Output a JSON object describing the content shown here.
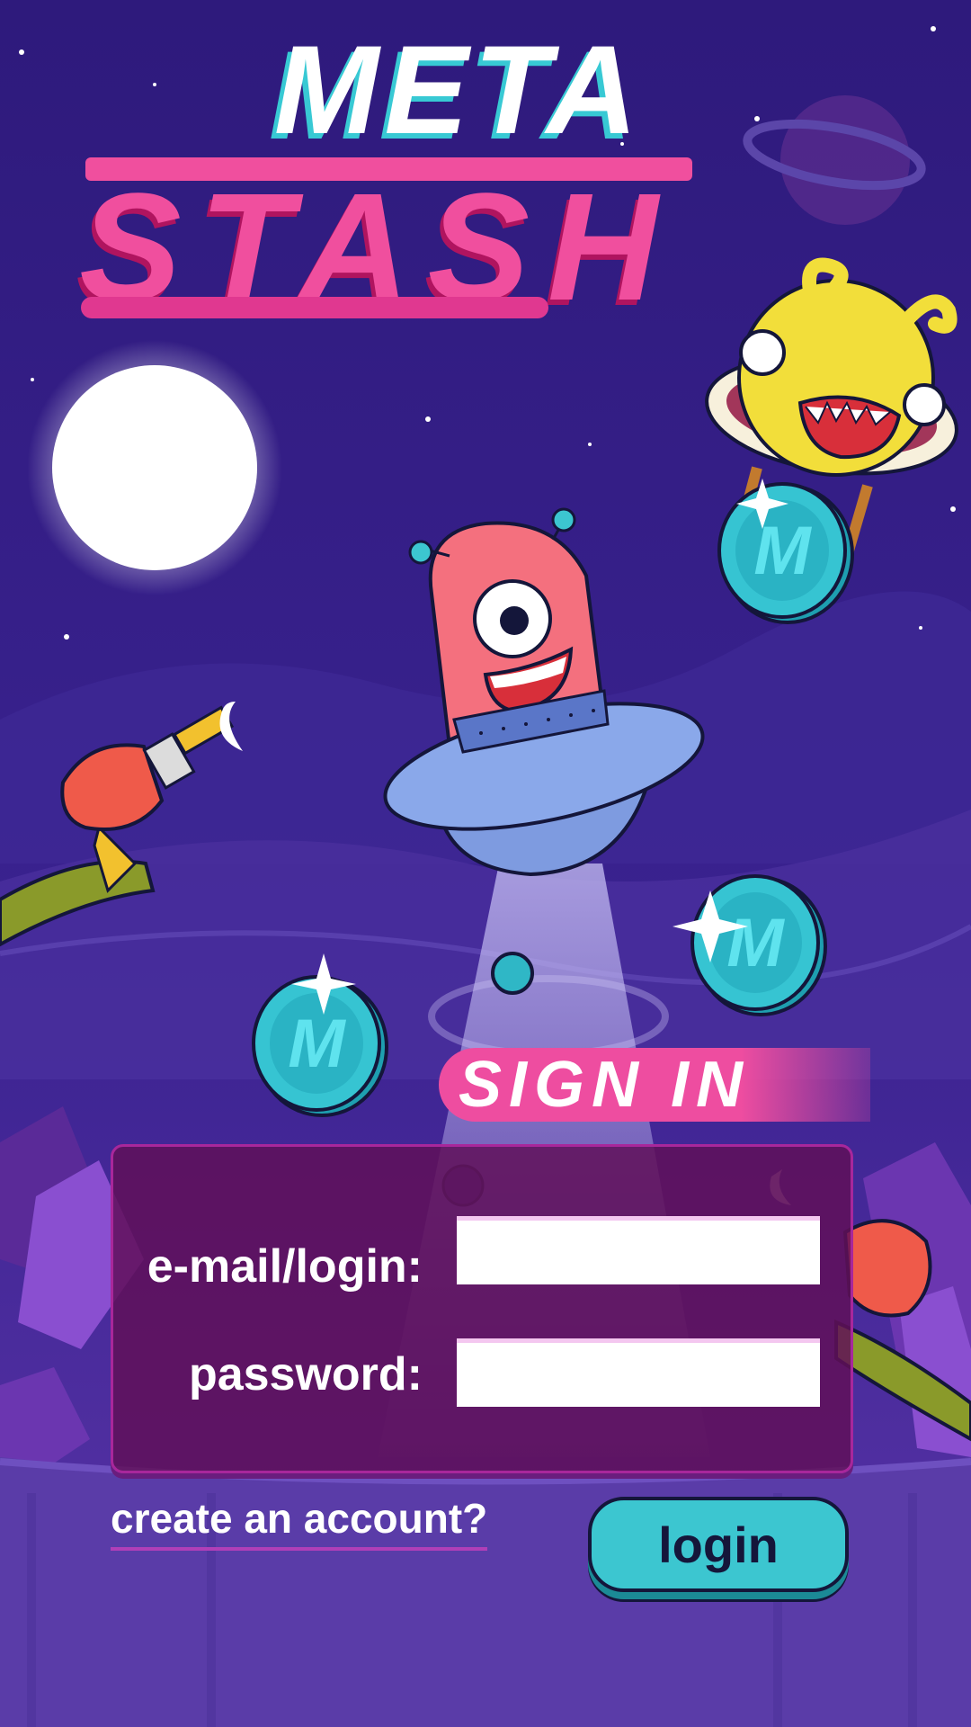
{
  "game": {
    "title_line1": "META",
    "title_line2": "STASH"
  },
  "signin": {
    "heading": "SIGN IN",
    "email_label": "e-mail/login:",
    "email_value": "",
    "password_label": "password:",
    "password_value": "",
    "create_account_link": "create an account?",
    "login_button": "login"
  },
  "coin": {
    "letter": "M"
  },
  "colors": {
    "sky": "#2b1a78",
    "accent_pink": "#f04f9e",
    "accent_cyan": "#3cc6d0",
    "panel": "#601058",
    "alien_pink": "#f4707e",
    "alien_yellow": "#f2de3a",
    "ufo_blue": "#7e9be0"
  },
  "icons": [
    "moon-icon",
    "planet-icon",
    "star-icon",
    "coin-icon",
    "ufo-icon",
    "pink-alien-icon",
    "yellow-alien-icon",
    "ray-gun-icon",
    "crystal-icon"
  ]
}
